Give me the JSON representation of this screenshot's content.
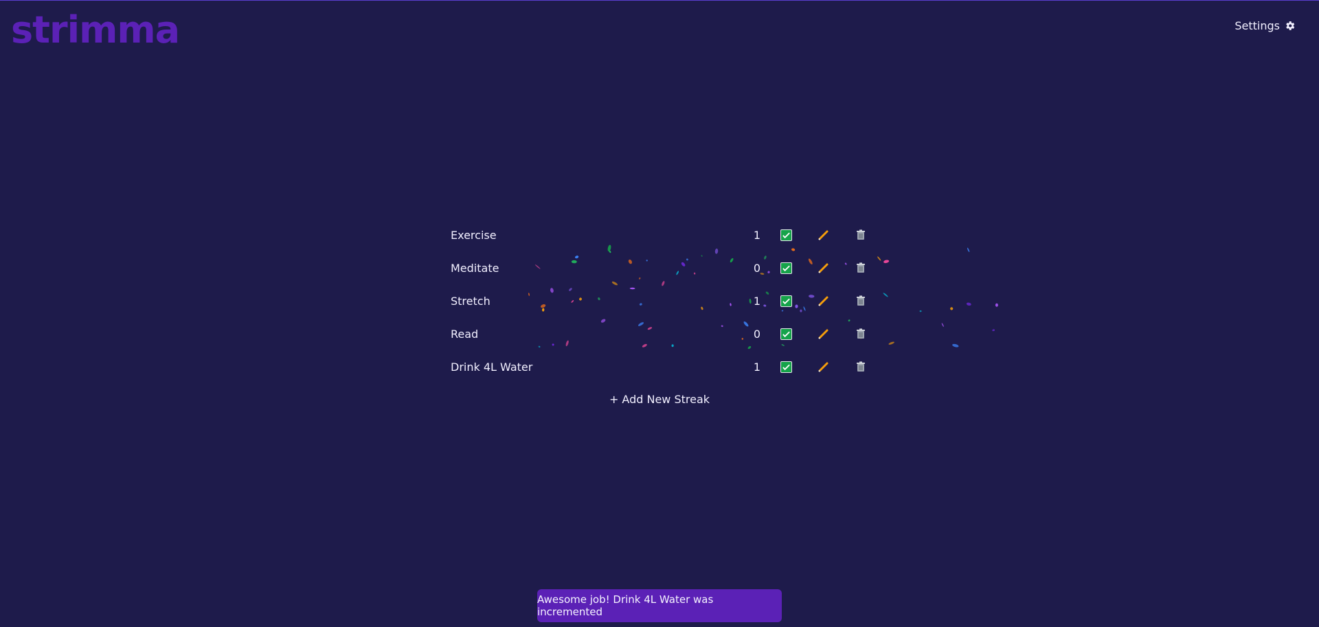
{
  "app": {
    "logo": "strimma",
    "settings_label": "Settings"
  },
  "streaks": [
    {
      "name": "Exercise",
      "count": "1"
    },
    {
      "name": "Meditate",
      "count": "0"
    },
    {
      "name": "Stretch",
      "count": "1"
    },
    {
      "name": "Read",
      "count": "0"
    },
    {
      "name": "Drink 4L Water",
      "count": "1"
    }
  ],
  "add_streak_label": "+ Add New Streak",
  "toast": {
    "message": "Awesome job! Drink 4L Water was incremented"
  },
  "icons": {
    "settings": "gear-icon",
    "complete": "checkbox-check-icon",
    "edit": "pencil-icon",
    "delete": "trash-icon"
  },
  "colors": {
    "background": "#1e1b4b",
    "brand": "#5b21b6",
    "check": "#16a34a",
    "pencil": "#f59e0b",
    "toast": "#5b21b6"
  }
}
